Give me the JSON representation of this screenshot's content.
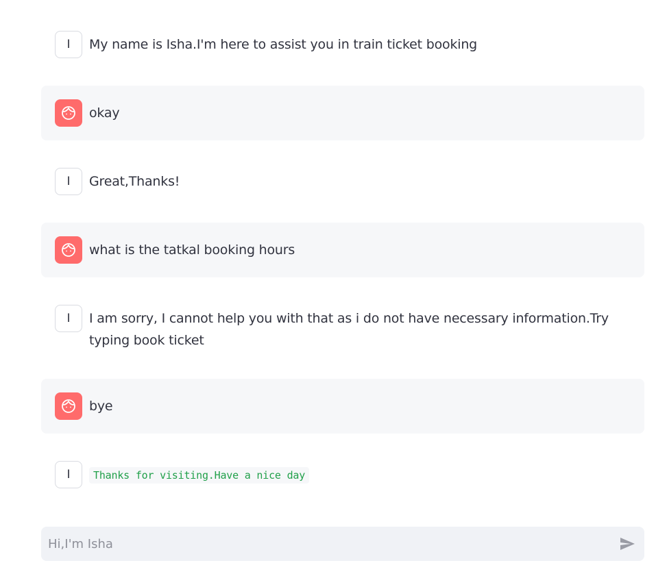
{
  "colors": {
    "assistant_bg": "#ffffff",
    "user_bg": "#f6f7f9",
    "user_avatar": "#ff6b6b",
    "code_text": "#21a04a",
    "input_bg": "#f0f2f6",
    "send_icon": "#9a9ca5"
  },
  "messages": [
    {
      "role": "assistant",
      "avatar": "I",
      "text": "My name is Isha.I'm here to assist you in train ticket booking"
    },
    {
      "role": "user",
      "avatar_icon": "face-icon",
      "text": "okay"
    },
    {
      "role": "assistant",
      "avatar": "I",
      "text": "Great,Thanks!"
    },
    {
      "role": "user",
      "avatar_icon": "face-icon",
      "text": "what is the tatkal booking hours"
    },
    {
      "role": "assistant",
      "avatar": "I",
      "text": "I am sorry, I cannot help you with that as i do not have necessary information.Try typing book ticket"
    },
    {
      "role": "user",
      "avatar_icon": "face-icon",
      "text": "bye"
    },
    {
      "role": "assistant",
      "avatar": "I",
      "text": "Thanks for visiting.Have a nice day",
      "format": "code"
    }
  ],
  "input": {
    "value": "",
    "placeholder": "Hi,I'm Isha",
    "send_icon": "send-icon"
  }
}
